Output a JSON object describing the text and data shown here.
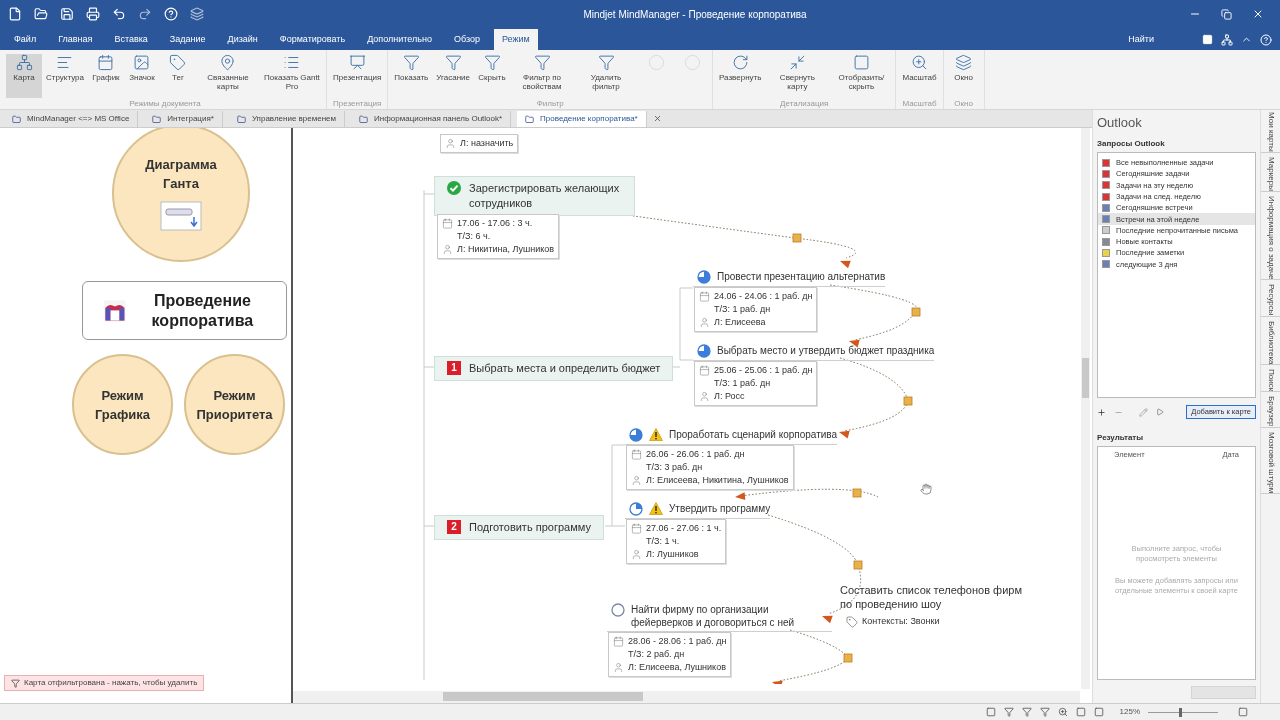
{
  "window": {
    "title": "Mindjet MindManager - Проведение корпоратива"
  },
  "ribbon": {
    "tabs": [
      {
        "label": "Файл",
        "selected": false
      },
      {
        "label": "Главная",
        "selected": false
      },
      {
        "label": "Вставка",
        "selected": false
      },
      {
        "label": "Задание",
        "selected": false
      },
      {
        "label": "Дизайн",
        "selected": false
      },
      {
        "label": "Форматировать",
        "selected": false
      },
      {
        "label": "Дополнительно",
        "selected": false
      },
      {
        "label": "Обзор",
        "selected": false
      },
      {
        "label": "Режим",
        "selected": true
      }
    ],
    "search": "Найти",
    "groups": [
      {
        "label": "Режимы документа",
        "buttons": [
          {
            "label": "Карта",
            "selected": true,
            "disabled": false
          },
          {
            "label": "Структура",
            "selected": false,
            "disabled": false
          },
          {
            "label": "График",
            "selected": false,
            "disabled": false
          },
          {
            "label": "Значок",
            "selected": false,
            "disabled": false
          },
          {
            "label": "Тег",
            "selected": false,
            "disabled": false
          },
          {
            "label": "Связанные карты",
            "selected": false,
            "disabled": false
          },
          {
            "label": "Показать Gantt Pro",
            "selected": false,
            "disabled": false
          }
        ]
      },
      {
        "label": "Презентация",
        "buttons": [
          {
            "label": "Презентация",
            "selected": false,
            "disabled": false
          }
        ]
      },
      {
        "label": "Фильтр",
        "buttons": [
          {
            "label": "Показать",
            "selected": false,
            "disabled": false
          },
          {
            "label": "Угасание",
            "selected": false,
            "disabled": false
          },
          {
            "label": "Скрыть",
            "selected": false,
            "disabled": false
          },
          {
            "label": "Фильтр по свойствам",
            "selected": false,
            "disabled": false
          },
          {
            "label": "Удалить фильтр",
            "selected": false,
            "disabled": false
          },
          {
            "selected": false,
            "disabled": true
          },
          {
            "selected": false,
            "disabled": true
          }
        ]
      },
      {
        "label": "Детализация",
        "buttons": [
          {
            "label": "Развернуть",
            "selected": false,
            "disabled": false
          },
          {
            "label": "Свернуть карту",
            "selected": false,
            "disabled": false
          },
          {
            "label": "Отобразить/скрыть",
            "selected": false,
            "disabled": false
          }
        ]
      },
      {
        "label": "Масштаб",
        "buttons": [
          {
            "label": "Масштаб",
            "selected": false,
            "disabled": false
          }
        ]
      },
      {
        "label": "Окно",
        "buttons": [
          {
            "label": "Окно",
            "selected": false,
            "disabled": false
          }
        ]
      }
    ]
  },
  "documents": [
    {
      "label": "MindManager <=> MS Office",
      "selected": false
    },
    {
      "label": "Интеграция*",
      "selected": false
    },
    {
      "label": "Управление временем",
      "selected": false
    },
    {
      "label": "Информационная панель Outlook*",
      "selected": false
    },
    {
      "label": "Проведение корпоратива*",
      "selected": true
    }
  ],
  "overview": [
    {
      "kind": "circle",
      "label": "Диаграмма Ганта"
    },
    {
      "kind": "central",
      "label": "Проведение корпоратива"
    },
    {
      "kind": "circle",
      "label": "Режим Графика"
    },
    {
      "kind": "circle",
      "label": "Режим Приоритета"
    }
  ],
  "filter_notice": "Карта отфильтрована - нажать, чтобы удалить",
  "topics": [
    {
      "kind": "details",
      "resources": "Л: назначить"
    },
    {
      "kind": "main",
      "title": "Зарегистрировать желающих сотрудников",
      "marker": {
        "kind": "check"
      },
      "dates": "17.06 - 17.06 : 3 ч.",
      "effort": "Т/З: 6 ч.",
      "resources": "Л: Никитина, Лушников"
    },
    {
      "kind": "sub",
      "title": "Провести презентацию альтернатив",
      "marker": {
        "kind": "threequarters"
      },
      "warning": false,
      "dates": "24.06 - 24.06 : 1 раб. дн",
      "effort": "Т/З: 1 раб. дн",
      "resources": "Л: Елисеева"
    },
    {
      "kind": "main",
      "title": "Выбрать места и определить бюджет",
      "marker": {
        "kind": "priority",
        "label": "1"
      }
    },
    {
      "kind": "sub",
      "title": "Выбрать место и утвердить бюджет праздника",
      "marker": {
        "kind": "threequarters"
      },
      "warning": false,
      "dates": "25.06 - 25.06 : 1 раб. дн",
      "effort": "Т/З: 1 раб. дн",
      "resources": "Л: Росс"
    },
    {
      "kind": "sub",
      "title": "Проработать сценарий корпоратива",
      "marker": {
        "kind": "threequarters"
      },
      "warning": true,
      "dates": "26.06 - 26.06 : 1 раб. дн",
      "effort": "Т/З: 3 раб. дн",
      "resources": "Л: Елисеева, Никитина, Лушников"
    },
    {
      "kind": "main",
      "title": "Подготовить программу",
      "marker": {
        "kind": "priority",
        "label": "2"
      }
    },
    {
      "kind": "sub",
      "title": "Утвердить программу",
      "marker": {
        "kind": "quarter"
      },
      "warning": true,
      "dates": "27.06 - 27.06 : 1 ч.",
      "effort": "Т/З: 1 ч.",
      "resources": "Л: Лушников"
    },
    {
      "kind": "sub",
      "title": "Найти фирму по организации фейерверков и договориться с ней",
      "marker": {
        "kind": "empty"
      },
      "warning": false,
      "dates": "28.06 - 28.06 : 1 раб. дн",
      "effort": "Т/З: 2 раб. дн",
      "resources": "Л: Елисеева, Лушников"
    },
    {
      "kind": "note",
      "title": "Составить список телефонов фирм по проведению шоу",
      "context": "Контексты: Звонки"
    }
  ],
  "outlook": {
    "title": "Outlook",
    "queries_label": "Запросы Outlook",
    "queries": [
      {
        "label": "Все невыполненные задачи",
        "selected": false
      },
      {
        "label": "Сегодняшние задачи",
        "selected": false
      },
      {
        "label": "Задачи на эту неделю",
        "selected": false
      },
      {
        "label": "Задачи на след. неделю",
        "selected": false
      },
      {
        "label": "Сегодняшние встречи",
        "selected": false
      },
      {
        "label": "Встречи на этой неделе",
        "selected": true
      },
      {
        "label": "Последние непрочитанные письма",
        "selected": false
      },
      {
        "label": "Новые контакты",
        "selected": false
      },
      {
        "label": "Последние заметки",
        "selected": false
      },
      {
        "label": "следующие 3 дня",
        "selected": false
      }
    ],
    "add_button": "Добавить к карте",
    "results_label": "Результаты",
    "columns": [
      "Элемент",
      "Дата"
    ],
    "hints": [
      "Выполните запрос, чтобы просмотреть элементы",
      "Вы можете добавлять запросы или отдельные элементы к своей карте"
    ]
  },
  "side_tabs": [
    "Мои карты",
    "Маркеры",
    "Информация о задаче",
    "Ресурсы",
    "Библиотека",
    "Поиск",
    "Браузер",
    "Мозговой штурм"
  ],
  "status_bar": {
    "zoom": "125%",
    "zoom_slider": {
      "level": 0.45
    }
  }
}
